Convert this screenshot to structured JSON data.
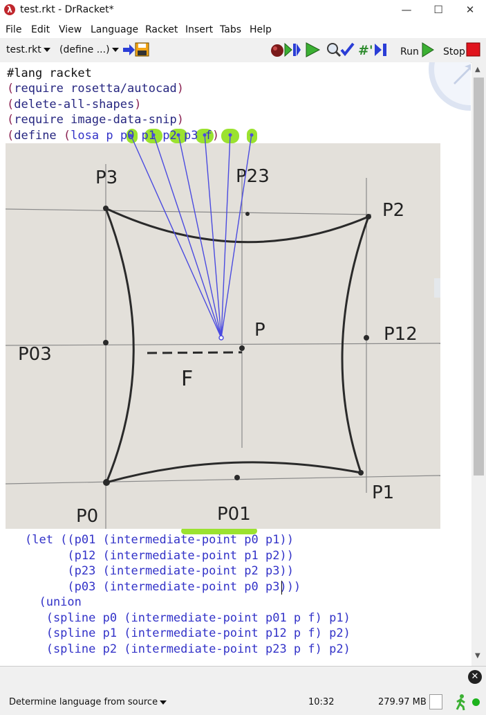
{
  "window": {
    "title": "test.rkt - DrRacket*",
    "app_icon_glyph": "λ"
  },
  "menu": [
    "File",
    "Edit",
    "View",
    "Language",
    "Racket",
    "Insert",
    "Tabs",
    "Help"
  ],
  "toolbar": {
    "file_label": "test.rkt",
    "define_label": "(define ...)",
    "run_label": "Run",
    "stop_label": "Stop"
  },
  "code": {
    "line1": "#lang racket",
    "line2_kw": "require",
    "line2_arg": "rosetta/autocad",
    "line3_kw": "delete-all-shapes",
    "line4_kw": "require",
    "line4_arg": "image-data-snip",
    "line5_kw": "define",
    "line5_name": "losa",
    "line5_args": "p p0 p1 p2 p3 f",
    "let_lines": [
      "(let ((p01 (intermediate-point p0 p1))",
      "      (p12 (intermediate-point p1 p2))",
      "      (p23 (intermediate-point p2 p3))",
      "      (p03 (intermediate-point p0 p3)))",
      "  (union",
      "   (spline p0 (intermediate-point p01 p f) p1)",
      "   (spline p1 (intermediate-point p12 p f) p2)",
      "   (spline p2 (intermediate-point p23 p f) p2)"
    ]
  },
  "sketch_labels": {
    "p3": "P3",
    "p23": "P23",
    "p2": "P2",
    "p03": "P03",
    "p": "P",
    "p12": "P12",
    "f": "F",
    "p0": "P0",
    "p01": "P01",
    "p1": "P1"
  },
  "status": {
    "language": "Determine language from source",
    "position": "10:32",
    "memory": "279.97 MB"
  },
  "colors": {
    "keyword": "#262680",
    "paren": "#8b2252",
    "identifier": "#3232c8",
    "highlight": "#9be22f",
    "arrow": "#4a4ae0"
  }
}
